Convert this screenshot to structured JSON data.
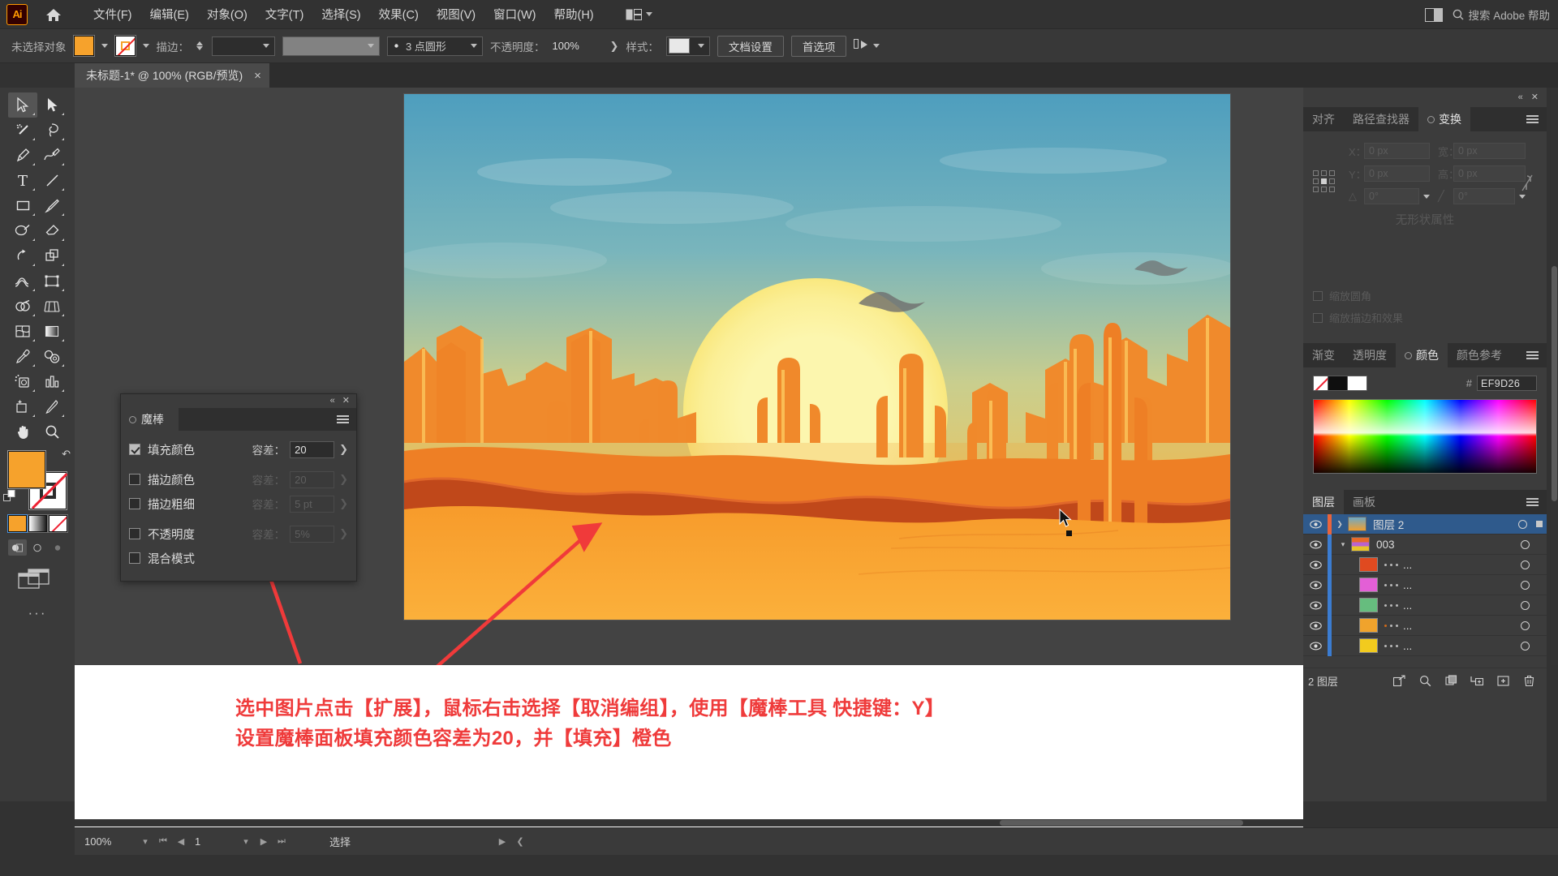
{
  "app": {
    "name": "Adobe Illustrator",
    "logo_text": "Ai"
  },
  "menubar": {
    "home_icon": "home-icon",
    "items": [
      {
        "label": "文件(F)"
      },
      {
        "label": "编辑(E)"
      },
      {
        "label": "对象(O)"
      },
      {
        "label": "文字(T)"
      },
      {
        "label": "选择(S)"
      },
      {
        "label": "效果(C)"
      },
      {
        "label": "视图(V)"
      },
      {
        "label": "窗口(W)"
      },
      {
        "label": "帮助(H)"
      }
    ],
    "workspace_switcher": "workspace-icon",
    "search_placeholder": "搜索 Adobe 帮助",
    "arrange_documents": "arrange-documents-icon"
  },
  "controlbar": {
    "selection_status": "未选择对象",
    "fill_color": "#F6A22C",
    "stroke_color": "#FFFFFF",
    "stroke_label": "描边：",
    "stroke_weight": "",
    "profile_value": "",
    "brush_value": "3 点圆形",
    "opacity_label": "不透明度：",
    "opacity_value": "100%",
    "style_label": "样式：",
    "document_setup": "文档设置",
    "preferences": "首选项",
    "align_icon": "align-icon"
  },
  "document_tab": {
    "title": "未标题-1* @ 100% (RGB/预览)",
    "close": "×"
  },
  "toolbar": {
    "tools": [
      {
        "name": "selection-tool",
        "active": true
      },
      {
        "name": "direct-selection-tool",
        "active": false
      },
      {
        "name": "magic-wand-tool",
        "active": false
      },
      {
        "name": "lasso-tool",
        "active": false
      },
      {
        "name": "pen-tool",
        "active": false
      },
      {
        "name": "curvature-tool",
        "active": false
      },
      {
        "name": "type-tool",
        "active": false
      },
      {
        "name": "line-segment-tool",
        "active": false
      },
      {
        "name": "rectangle-tool",
        "active": false
      },
      {
        "name": "paintbrush-tool",
        "active": false
      },
      {
        "name": "shaper-tool",
        "active": false
      },
      {
        "name": "eraser-tool",
        "active": false
      },
      {
        "name": "rotate-tool",
        "active": false
      },
      {
        "name": "scale-tool",
        "active": false
      },
      {
        "name": "width-tool",
        "active": false
      },
      {
        "name": "free-transform-tool",
        "active": false
      },
      {
        "name": "shape-builder-tool",
        "active": false
      },
      {
        "name": "perspective-grid-tool",
        "active": false
      },
      {
        "name": "mesh-tool",
        "active": false
      },
      {
        "name": "gradient-tool",
        "active": false
      },
      {
        "name": "eyedropper-tool",
        "active": false
      },
      {
        "name": "blend-tool",
        "active": false
      },
      {
        "name": "symbol-sprayer-tool",
        "active": false
      },
      {
        "name": "column-graph-tool",
        "active": false
      },
      {
        "name": "artboard-tool",
        "active": false
      },
      {
        "name": "slice-tool",
        "active": false
      },
      {
        "name": "hand-tool",
        "active": false
      },
      {
        "name": "zoom-tool",
        "active": false
      }
    ],
    "fill_color": "#F6A22C",
    "stroke_color": "#FFFFFF",
    "fill_mode": "solid-color",
    "more_tools": "···"
  },
  "wand_panel": {
    "title": "魔棒",
    "collapse_icon": "collapse-icon",
    "close_icon": "close-icon",
    "menu_icon": "panel-menu-icon",
    "rows": [
      {
        "label": "填充颜色",
        "checked": true,
        "tolerance_label": "容差：",
        "tolerance_value": "20",
        "enabled": true
      },
      {
        "label": "描边颜色",
        "checked": false,
        "tolerance_label": "容差：",
        "tolerance_value": "20",
        "enabled": false
      },
      {
        "label": "描边粗细",
        "checked": false,
        "tolerance_label": "容差：",
        "tolerance_value": "5 pt",
        "enabled": false
      },
      {
        "label": "不透明度",
        "checked": false,
        "tolerance_label": "容差：",
        "tolerance_value": "5%",
        "enabled": false
      },
      {
        "label": "混合模式",
        "checked": false,
        "tolerance_label": "",
        "tolerance_value": "",
        "enabled": false
      }
    ]
  },
  "transform_panel": {
    "tabs": [
      {
        "label": "对齐",
        "active": false
      },
      {
        "label": "路径查找器",
        "active": false
      },
      {
        "label": "变换",
        "active": true
      }
    ],
    "fields": [
      {
        "key": "X：",
        "value": "0 px"
      },
      {
        "key": "宽：",
        "value": "0 px"
      },
      {
        "key": "Y：",
        "value": "0 px"
      },
      {
        "key": "高：",
        "value": "0 px"
      },
      {
        "key": "角度：",
        "value": "0°"
      },
      {
        "key": "倾斜：",
        "value": "0°"
      }
    ],
    "lock_icon": "unlink-icon",
    "empty_text": "无形状属性",
    "options": [
      {
        "label": "缩放圆角"
      },
      {
        "label": "缩放描边和效果"
      }
    ]
  },
  "color_panel": {
    "tabs": [
      {
        "label": "渐变",
        "active": false
      },
      {
        "label": "透明度",
        "active": false
      },
      {
        "label": "颜色",
        "active": true
      },
      {
        "label": "颜色参考",
        "active": false
      }
    ],
    "hex_prefix": "#",
    "hex_value": "EF9D26",
    "swatch_none": "none-swatch",
    "swatch_black": "#0F0F0F",
    "swatch_white": "#FFFFFF"
  },
  "layers_panel": {
    "tabs": [
      {
        "label": "图层",
        "active": true
      },
      {
        "label": "画板",
        "active": false
      }
    ],
    "rows": [
      {
        "name": "图层 2",
        "selected": true,
        "indent": 0,
        "expander": "collapsed",
        "thumb": "artwork-thumb",
        "marker": "#E8643C",
        "dots": []
      },
      {
        "name": "003",
        "selected": false,
        "indent": 1,
        "expander": "expanded",
        "thumb": "group-thumb",
        "marker": "#3B7CD1",
        "dots": []
      },
      {
        "name": "...",
        "selected": false,
        "indent": 2,
        "expander": "none",
        "thumb": "#E04A20",
        "marker": "#3B7CD1",
        "dots": [
          "n",
          "n",
          "n"
        ]
      },
      {
        "name": "...",
        "selected": false,
        "indent": 2,
        "expander": "none",
        "thumb": "#E35FD6",
        "marker": "#3B7CD1",
        "dots": [
          "n",
          "n",
          "n"
        ]
      },
      {
        "name": "...",
        "selected": false,
        "indent": 2,
        "expander": "none",
        "thumb": "#66BD7E",
        "marker": "#3B7CD1",
        "dots": [
          "n",
          "n",
          "n"
        ]
      },
      {
        "name": "...",
        "selected": false,
        "indent": 2,
        "expander": "none",
        "thumb": "#F0A32C",
        "marker": "#3B7CD1",
        "dots": [
          "o",
          "n",
          "n"
        ]
      },
      {
        "name": "...",
        "selected": false,
        "indent": 2,
        "expander": "none",
        "thumb": "#F2CB1E",
        "marker": "#3B7CD1",
        "dots": [
          "n",
          "n",
          "n"
        ]
      }
    ],
    "footer_count": "2 图层",
    "footer_buttons": [
      {
        "name": "release-to-layers-button"
      },
      {
        "name": "locate-object-button"
      },
      {
        "name": "make-clipping-mask-button"
      },
      {
        "name": "create-sublayer-button"
      },
      {
        "name": "create-new-layer-button"
      },
      {
        "name": "delete-layer-button"
      }
    ]
  },
  "statusbar": {
    "zoom": "100%",
    "page": "1",
    "status_text": "选择"
  },
  "annotation": {
    "line1": "选中图片点击【扩展】，鼠标右击选择【取消编组】，使用【魔棒工具 快捷键：Y】",
    "line2": "设置魔棒面板填充颜色容差为20，并【填充】橙色",
    "color": "#EF3B3B"
  },
  "artwork": {
    "title": "沙漠日落仙人掌插画",
    "sky_top": "#5CA9C4",
    "sky_mid": "#E9C96A",
    "sun": "#FBF3A0",
    "sand_far": "#F0892B",
    "sand_near": "#F8A22D",
    "rock_dark": "#C0481A",
    "cactus": "#F0892B"
  }
}
